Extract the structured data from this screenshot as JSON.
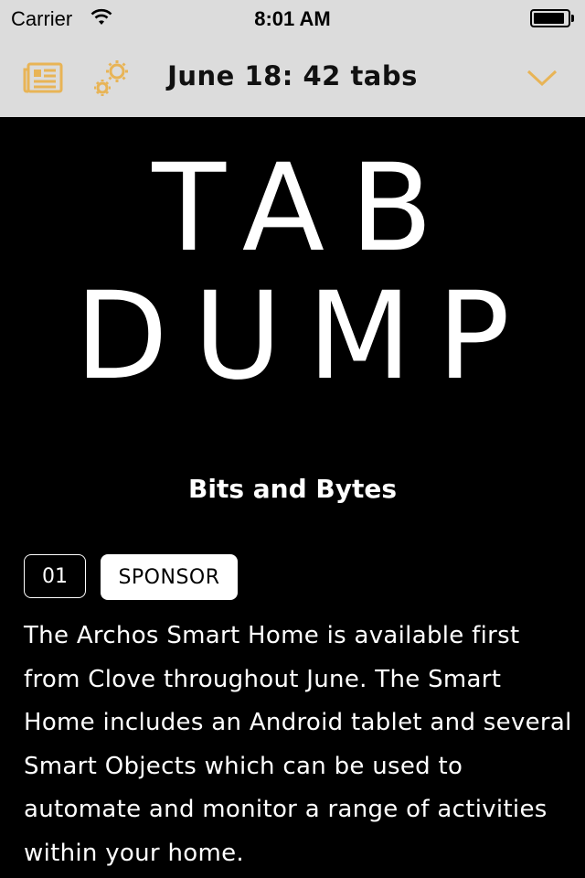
{
  "status_bar": {
    "carrier": "Carrier",
    "time": "8:01 AM",
    "battery_level": 0.92,
    "icons": [
      "wifi-icon",
      "battery-icon"
    ]
  },
  "nav": {
    "title": "June 18: 42 tabs",
    "accent_color": "#e8b456",
    "icons": [
      "list-icon",
      "gears-icon",
      "chevron-down-icon"
    ]
  },
  "hero": {
    "line1": "TAB",
    "line2": "DUMP"
  },
  "section": {
    "title": "Bits and Bytes"
  },
  "item": {
    "number": "01",
    "tag": "SPONSOR",
    "text": "The Archos Smart Home is available first from Clove throughout June. The Smart Home includes an Android tablet and several Smart Objects which can be used to automate and monitor a range of activities within your home."
  },
  "colors": {
    "background": "#000000",
    "bar": "#dcdcdc",
    "text": "#ffffff"
  }
}
